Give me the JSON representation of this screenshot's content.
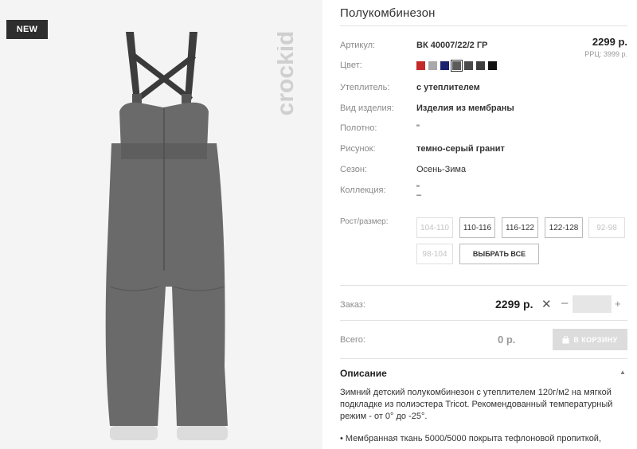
{
  "product": {
    "badge": "NEW",
    "brand": "crockid",
    "title": "Полукомбинезон",
    "price": "2299 р.",
    "rrp": "РРЦ: 3999 р."
  },
  "specs": {
    "article_label": "Артикул:",
    "article_value": "ВК 40007/22/2 ГР",
    "color_label": "Цвет:",
    "insulation_label": "Утеплитель:",
    "insulation_value": "с утеплителем",
    "kind_label": "Вид изделия:",
    "kind_value": "Изделия из мембраны",
    "fabric_label": "Полотно:",
    "fabric_value": "\"",
    "pattern_label": "Рисунок:",
    "pattern_value": "темно-серый гранит",
    "season_label": "Сезон:",
    "season_value": "Осень-Зима",
    "collection_label": "Коллекция:",
    "collection_value_1": "\"",
    "collection_value_2": "–"
  },
  "swatches": [
    {
      "name": "red",
      "color": "#c42a2a"
    },
    {
      "name": "light-gray",
      "color": "#a9a9a9"
    },
    {
      "name": "navy",
      "color": "#1c2270"
    },
    {
      "name": "dark-gray",
      "color": "#5b5b5b",
      "selected": true
    },
    {
      "name": "graphite",
      "color": "#4a4a4a"
    },
    {
      "name": "charcoal",
      "color": "#3e3e3e"
    },
    {
      "name": "black",
      "color": "#111111"
    }
  ],
  "sizes": {
    "label": "Рост/размер:",
    "options": [
      {
        "label": "104-110",
        "available": false
      },
      {
        "label": "110-116",
        "available": true
      },
      {
        "label": "116-122",
        "available": true
      },
      {
        "label": "122-128",
        "available": true
      },
      {
        "label": "92-98",
        "available": false
      },
      {
        "label": "98-104",
        "available": false
      }
    ],
    "select_all": "ВЫБРАТЬ ВСЕ"
  },
  "order": {
    "label": "Заказ:",
    "price": "2299 р.",
    "remove": "✕",
    "minus": "–",
    "quantity": "",
    "plus": "+"
  },
  "total": {
    "label": "Всего:",
    "value": "0 р.",
    "cart_button": "В КОРЗИНУ"
  },
  "description": {
    "title": "Описание",
    "text": "Зимний детский полукомбинезон с утеплителем 120г/м2 на мягкой подкладке из полиэстера Tricot. Рекомендованный температурный режим - от 0° до -25°.",
    "bullet": "• Мембранная ткань 5000/5000 покрыта тефлоновой пропиткой,"
  },
  "colors": {
    "garment": "#6a6a6b",
    "photo_bg": "#f4f4f4",
    "badge_bg": "#2e2e2e",
    "cart_disabled": "#dcdcdc"
  }
}
